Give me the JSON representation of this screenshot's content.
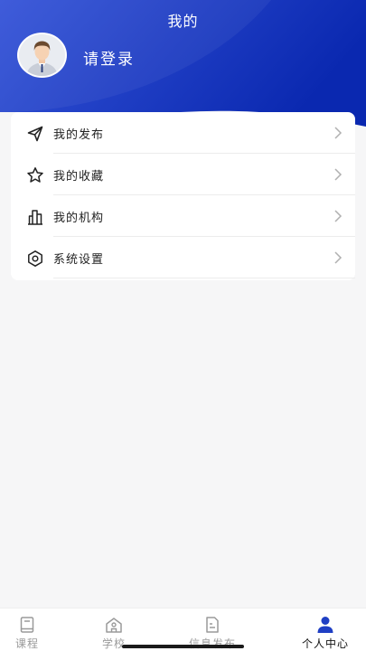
{
  "header": {
    "title": "我的",
    "login_text": "请登录",
    "gradient_start": "#2f4fd6",
    "gradient_end": "#0a2bb5"
  },
  "menu": {
    "items": [
      {
        "label": "我的发布",
        "icon": "send-icon"
      },
      {
        "label": "我的收藏",
        "icon": "star-icon"
      },
      {
        "label": "我的机构",
        "icon": "buildings-icon"
      },
      {
        "label": "系统设置",
        "icon": "settings-icon"
      }
    ]
  },
  "tabbar": {
    "tabs": [
      {
        "label": "课程",
        "icon": "book-icon",
        "active": false
      },
      {
        "label": "学校",
        "icon": "school-icon",
        "active": false
      },
      {
        "label": "信息发布",
        "icon": "document-icon",
        "active": false
      },
      {
        "label": "个人中心",
        "icon": "person-icon",
        "active": true
      }
    ],
    "active_color": "#1f3fc4",
    "inactive_color": "#9a9a9a"
  }
}
